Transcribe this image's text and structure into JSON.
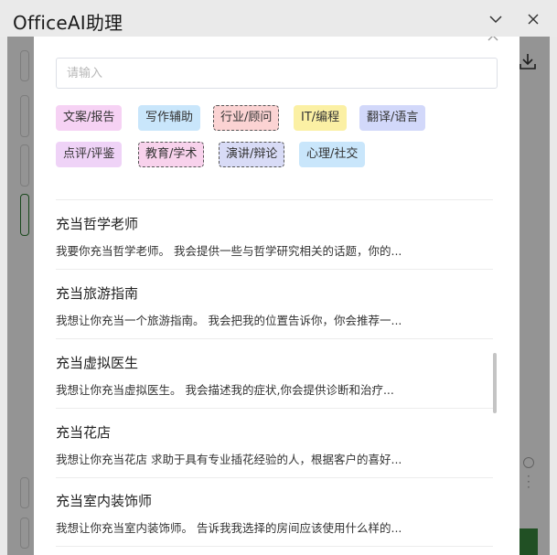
{
  "window": {
    "title": "OfficeAI助理",
    "chevron_icon": "chevron-down-icon",
    "close_icon": "close-icon"
  },
  "search": {
    "placeholder": "请输入",
    "value": ""
  },
  "categories": [
    {
      "label": "文案/报告",
      "color": "#f6d2f4",
      "selected": false
    },
    {
      "label": "写作辅助",
      "color": "#c9e6fb",
      "selected": false
    },
    {
      "label": "行业/顾问",
      "color": "#fbd3d3",
      "selected": true
    },
    {
      "label": "IT/编程",
      "color": "#fbf0a4",
      "selected": false
    },
    {
      "label": "翻译/语言",
      "color": "#d2d8fa",
      "selected": false
    },
    {
      "label": "点评/评鉴",
      "color": "#efd3f7",
      "selected": false
    },
    {
      "label": "教育/学术",
      "color": "#f8d2ec",
      "selected": true
    },
    {
      "label": "演讲/辩论",
      "color": "#d8dbf6",
      "selected": true
    },
    {
      "label": "心理/社交",
      "color": "#c9e6fb",
      "selected": false
    }
  ],
  "prompts": [
    {
      "title": "充当哲学老师",
      "desc": "我要你充当哲学老师。 我会提供一些与哲学研究相关的话题，你的..."
    },
    {
      "title": "充当旅游指南",
      "desc": "我想让你充当一个旅游指南。 我会把我的位置告诉你，你会推荐一..."
    },
    {
      "title": "充当虚拟医生",
      "desc": "我想让你充当虚拟医生。 我会描述我的症状,你会提供诊断和治疗..."
    },
    {
      "title": "充当花店",
      "desc": "我想让你充当花店 求助于具有专业插花经验的人，根据客户的喜好..."
    },
    {
      "title": "充当室内装饰师",
      "desc": "我想让你充当室内装饰师。 告诉我我选择的房间应该使用什么样的..."
    }
  ]
}
